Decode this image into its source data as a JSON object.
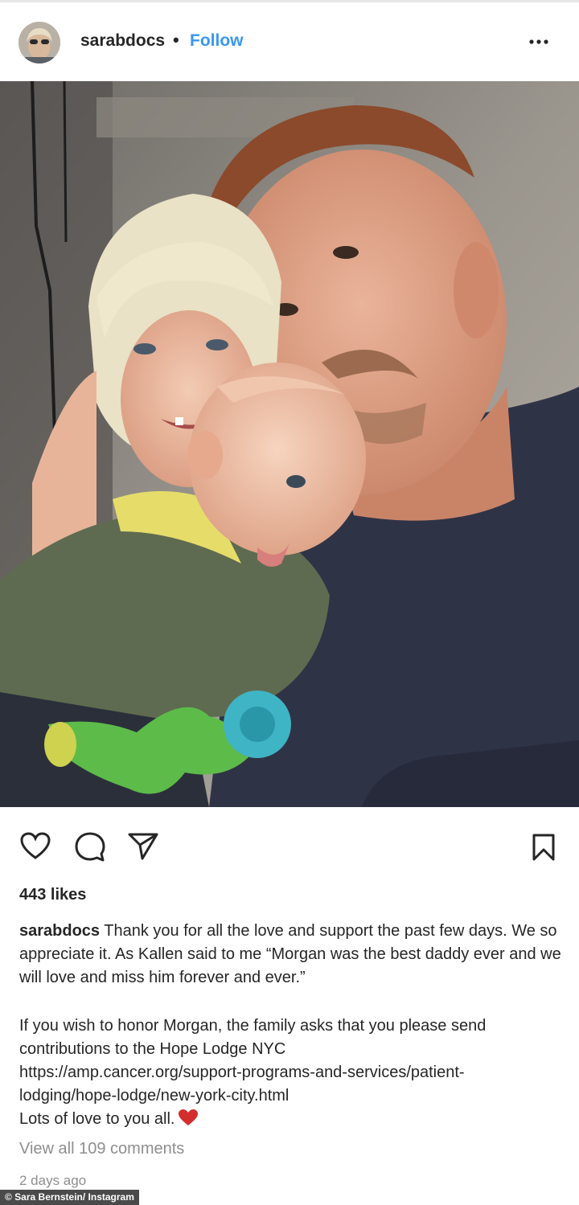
{
  "post": {
    "username": "sarabdocs",
    "separator": "•",
    "follow_label": "Follow",
    "more_icon": "more-horizontal-icon"
  },
  "actions": {
    "like_icon": "heart-outline-icon",
    "comment_icon": "comment-bubble-icon",
    "share_icon": "send-paper-plane-icon",
    "save_icon": "bookmark-outline-icon"
  },
  "likes_text": "443 likes",
  "caption": {
    "username": "sarabdocs",
    "paragraph1": "Thank you for all the love and support the past few days. We so appreciate it. As Kallen said to me “Morgan was the best daddy ever and we will love and miss him forever and ever.”",
    "line_a": "If you wish to honor Morgan, the family asks that you please send",
    "line_b": "contributions to the Hope Lodge NYC",
    "line_c": "https://amp.cancer.org/support-programs-and-services/patient-",
    "line_d": "lodging/hope-lodge/new-york-city.html",
    "line_e": "Lots of love to you all.",
    "emoji_icon": "red-heart-emoji-icon"
  },
  "view_comments": "View all 109 comments",
  "timestamp": "2 days ago",
  "credit": "© Sara Bernstein/ Instagram",
  "colors": {
    "follow_blue": "#3897f0",
    "muted_gray": "#8e8e8e",
    "text": "#262626",
    "heart_red": "#d32e2e"
  }
}
